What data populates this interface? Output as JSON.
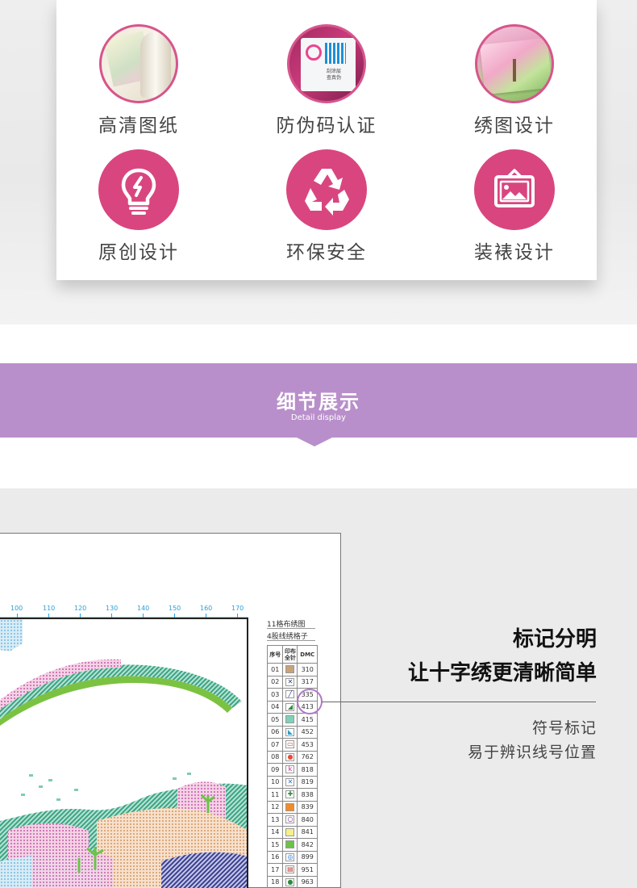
{
  "features": [
    {
      "label": "高清图纸",
      "icon": "paper-photo-icon"
    },
    {
      "label": "防伪码认证",
      "icon": "anti-counterfeit-qr-photo-icon"
    },
    {
      "label": "绣图设计",
      "icon": "embroidery-photo-icon"
    },
    {
      "label": "原创设计",
      "icon": "lightbulb-icon"
    },
    {
      "label": "环保安全",
      "icon": "recycle-icon"
    },
    {
      "label": "装裱设计",
      "icon": "picture-frame-icon"
    }
  ],
  "qr_card_text": [
    "刮涂层",
    "查真伪"
  ],
  "section": {
    "title": "细节展示",
    "subtitle": "Detail display"
  },
  "pattern": {
    "ruler_ticks": [
      "100",
      "110",
      "120",
      "130",
      "140",
      "150",
      "160",
      "170"
    ],
    "legend_title_1": "11格布绣图",
    "legend_title_2": "4股线绣格子",
    "legend_headers": [
      "序号",
      "印布全针",
      "DMC"
    ],
    "legend_rows": [
      {
        "no": "01",
        "dmc": "310"
      },
      {
        "no": "02",
        "dmc": "317"
      },
      {
        "no": "03",
        "dmc": "335"
      },
      {
        "no": "04",
        "dmc": "413"
      },
      {
        "no": "05",
        "dmc": "415"
      },
      {
        "no": "06",
        "dmc": "452"
      },
      {
        "no": "07",
        "dmc": "453"
      },
      {
        "no": "08",
        "dmc": "762"
      },
      {
        "no": "09",
        "dmc": "818"
      },
      {
        "no": "10",
        "dmc": "819"
      },
      {
        "no": "11",
        "dmc": "838"
      },
      {
        "no": "12",
        "dmc": "839"
      },
      {
        "no": "13",
        "dmc": "840"
      },
      {
        "no": "14",
        "dmc": "841"
      },
      {
        "no": "15",
        "dmc": "842"
      },
      {
        "no": "16",
        "dmc": "899"
      },
      {
        "no": "17",
        "dmc": "951"
      },
      {
        "no": "18",
        "dmc": "963"
      }
    ],
    "legend_symbol_colors": [
      "#c9a27a",
      "#ffffff",
      "#ffffff",
      "#ffffff",
      "#7fd2b8",
      "#ffffff",
      "#ffffff",
      "#ffffff",
      "#ffffff",
      "#ffffff",
      "#ffffff",
      "#f28c28",
      "#ffffff",
      "#f6f08a",
      "#6cc24a",
      "#ffffff",
      "#ffffff",
      "#ffffff"
    ],
    "legend_symbol_glyphs": [
      "",
      "✕",
      "╱",
      "◢",
      "",
      "◣",
      "▭",
      "●",
      "k",
      "✕",
      "✚",
      "",
      "○",
      "",
      "",
      "◎",
      "▤",
      "●"
    ],
    "legend_glyph_colors": [
      "",
      "#2b3a8a",
      "#2b3a8a",
      "#2e8b3e",
      "",
      "#2aa0c8",
      "#c0392b",
      "#e74c3c",
      "#c71585",
      "#1e6fd9",
      "#2e8b3e",
      "",
      "#6a1b9a",
      "",
      "",
      "#1e6fd9",
      "#c0392b",
      "#2e8b3e"
    ]
  },
  "headline": {
    "line1": "标记分明",
    "line2": "让十字绣更清晰简单"
  },
  "description": {
    "line1": "符号标记",
    "line2": "易于辨识线号位置"
  }
}
